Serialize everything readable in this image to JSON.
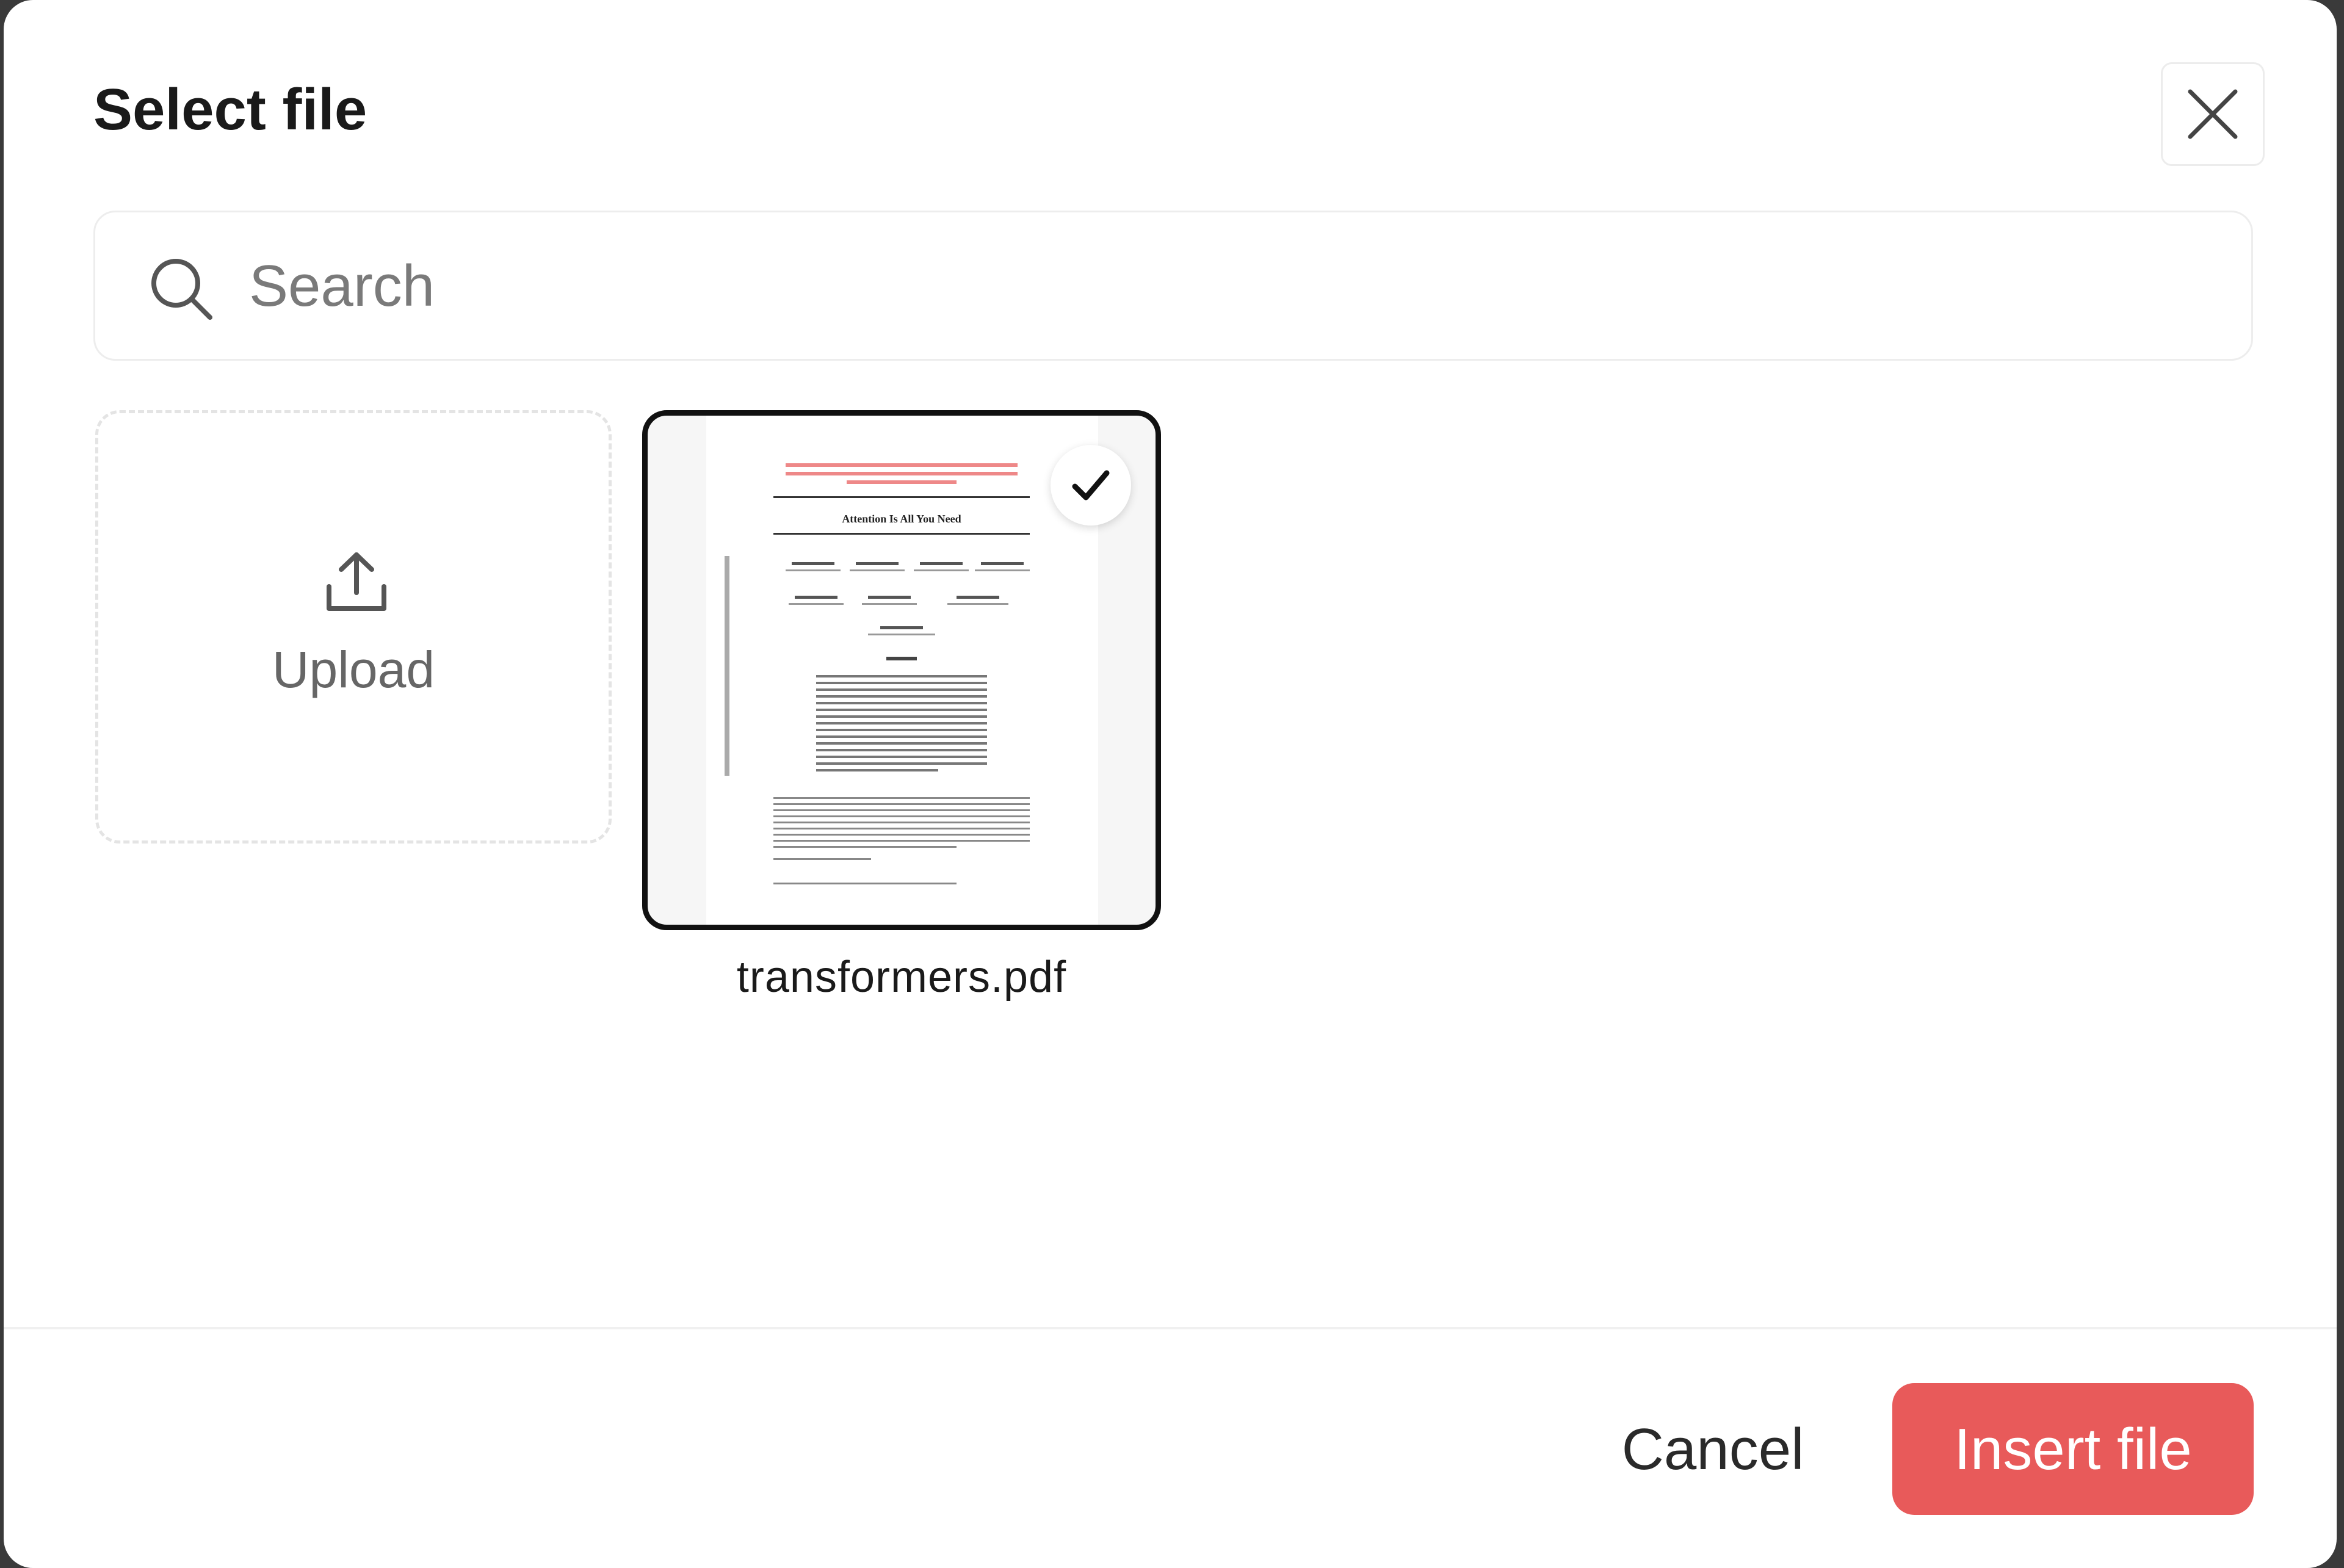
{
  "dialog": {
    "title": "Select file",
    "close_icon": "close-icon"
  },
  "search": {
    "placeholder": "Search",
    "value": "",
    "icon": "search-icon"
  },
  "upload": {
    "label": "Upload",
    "icon": "upload-icon"
  },
  "files": [
    {
      "name": "transformers.pdf",
      "selected": true,
      "thumbnail_title": "Attention Is All You Need",
      "badge_icon": "check-icon"
    }
  ],
  "footer": {
    "cancel_label": "Cancel",
    "insert_label": "Insert file"
  },
  "colors": {
    "accent": "#e85a5a",
    "selected_border": "#111111",
    "header_text": "#1a1a1a"
  }
}
